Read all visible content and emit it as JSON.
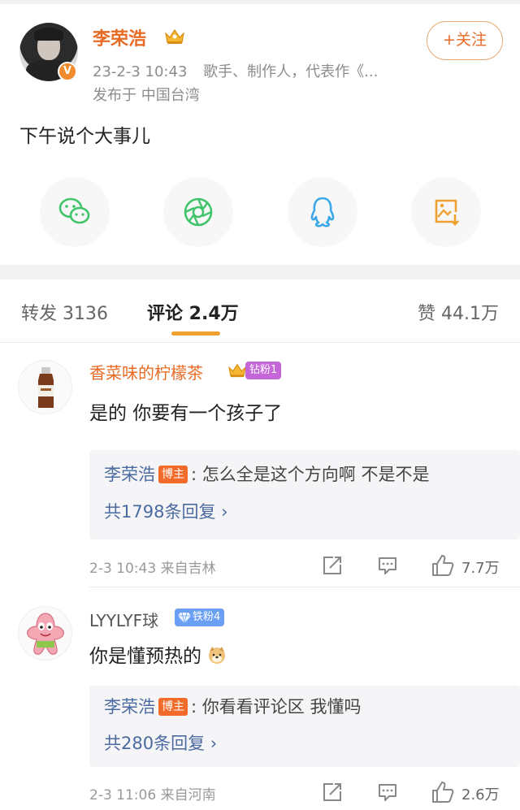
{
  "post": {
    "author": "李荣浩",
    "verified_mark": "V",
    "date_time": "23-2-3 10:43",
    "bio": "歌手、制作人，代表作《...",
    "location_line": "发布于 中国台湾",
    "follow_label": "+关注",
    "content": "下午说个大事儿",
    "share_targets": [
      "wechat-icon",
      "moments-icon",
      "qq-icon",
      "save-image-icon"
    ]
  },
  "tabs": {
    "repost": "转发 3136",
    "comments": "评论 2.4万",
    "likes": "赞 44.1万"
  },
  "comments": [
    {
      "name": "香菜味的柠檬茶",
      "fan_badge": "钻粉1",
      "text": "是的 你要有一个孩子了",
      "reply": {
        "author": "李荣浩",
        "tag": "博主",
        "colon": ":",
        "content": "怎么全是这个方向啊 不是不是",
        "count_label": "共1798条回复 ›"
      },
      "meta": "2-3 10:43  来自吉林",
      "likes": "7.7万"
    },
    {
      "name": "LYYLYF球",
      "fan_badge": "铁粉4",
      "text": "你是懂预热的",
      "reply": {
        "author": "李荣浩",
        "tag": "博主",
        "colon": ":",
        "content": "你看看评论区 我懂吗",
        "count_label": "共280条回复 ›"
      },
      "meta": "2-3 11:06  来自河南",
      "likes": "2.6万"
    }
  ],
  "colors": {
    "accent_orange": "#e86b25",
    "link_blue": "#4b6aa0",
    "tab_underline": "#f0a030",
    "wechat_green": "#3fc46a",
    "qq_blue": "#3aa8e8",
    "save_orange": "#f0a030"
  }
}
